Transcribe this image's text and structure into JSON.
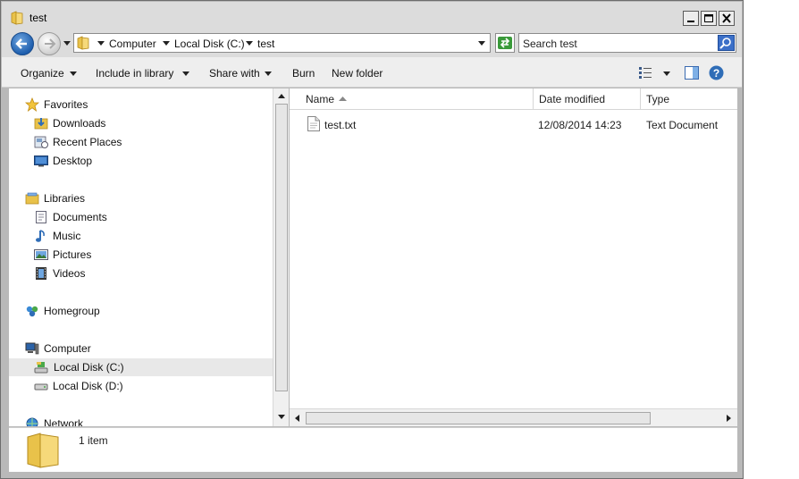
{
  "window": {
    "title": "test"
  },
  "address": {
    "crumbs": [
      "Computer",
      "Local Disk (C:)",
      "test"
    ],
    "search_placeholder": "Search test"
  },
  "toolbar": {
    "organize": "Organize",
    "include_in_library": "Include in library",
    "share_with": "Share with",
    "burn": "Burn",
    "new_folder": "New folder"
  },
  "nav": {
    "favorites": "Favorites",
    "downloads": "Downloads",
    "recent_places": "Recent Places",
    "desktop": "Desktop",
    "libraries": "Libraries",
    "documents": "Documents",
    "music": "Music",
    "pictures": "Pictures",
    "videos": "Videos",
    "homegroup": "Homegroup",
    "computer": "Computer",
    "local_disk_c": "Local Disk (C:)",
    "local_disk_d": "Local Disk (D:)",
    "network": "Network"
  },
  "columns": {
    "name": "Name",
    "date_modified": "Date modified",
    "type": "Type"
  },
  "files": [
    {
      "name": "test.txt",
      "date_modified": "12/08/2014 14:23",
      "type": "Text Document"
    }
  ],
  "status": {
    "count": "1 item"
  },
  "colors": {
    "accent": "#2f6db7",
    "folder": "#e9c24a",
    "selected_row": "#e8e8e8"
  }
}
